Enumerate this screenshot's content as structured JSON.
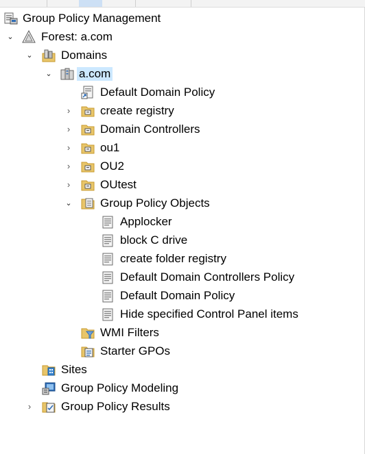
{
  "tree": {
    "root": {
      "label": "Group Policy Management",
      "icon": "gpm-console-icon"
    },
    "forest": {
      "label": "Forest: a.com",
      "icon": "forest-icon"
    },
    "domains": {
      "label": "Domains",
      "icon": "domains-icon"
    },
    "domain": {
      "label": "a.com",
      "icon": "domain-icon"
    },
    "default_domain_policy_link": {
      "label": "Default Domain Policy",
      "icon": "gpo-link-icon"
    },
    "ous": [
      {
        "label": "create registry",
        "icon": "ou-icon"
      },
      {
        "label": "Domain Controllers",
        "icon": "ou-icon"
      },
      {
        "label": "ou1",
        "icon": "ou-icon"
      },
      {
        "label": "OU2",
        "icon": "ou-icon"
      },
      {
        "label": "OUtest",
        "icon": "ou-icon"
      }
    ],
    "gpo_container": {
      "label": "Group Policy Objects",
      "icon": "gpo-folder-icon"
    },
    "gpos": [
      {
        "label": "Applocker",
        "icon": "gpo-icon"
      },
      {
        "label": "block C drive",
        "icon": "gpo-icon"
      },
      {
        "label": "create folder registry",
        "icon": "gpo-icon"
      },
      {
        "label": "Default Domain Controllers Policy",
        "icon": "gpo-icon"
      },
      {
        "label": "Default Domain Policy",
        "icon": "gpo-icon"
      },
      {
        "label": "Hide specified Control Panel items",
        "icon": "gpo-icon"
      }
    ],
    "wmi_filters": {
      "label": "WMI Filters",
      "icon": "wmi-filter-icon"
    },
    "starter_gpos": {
      "label": "Starter GPOs",
      "icon": "starter-gpo-icon"
    },
    "sites": {
      "label": "Sites",
      "icon": "sites-icon"
    },
    "modeling": {
      "label": "Group Policy Modeling",
      "icon": "modeling-icon"
    },
    "results": {
      "label": "Group Policy Results",
      "icon": "results-icon"
    }
  },
  "colors": {
    "selection": "#cce8ff",
    "folder": "#e8c56a",
    "folder_dark": "#c79a2e",
    "doc": "#f4f4f4",
    "blue": "#2f6db5"
  }
}
